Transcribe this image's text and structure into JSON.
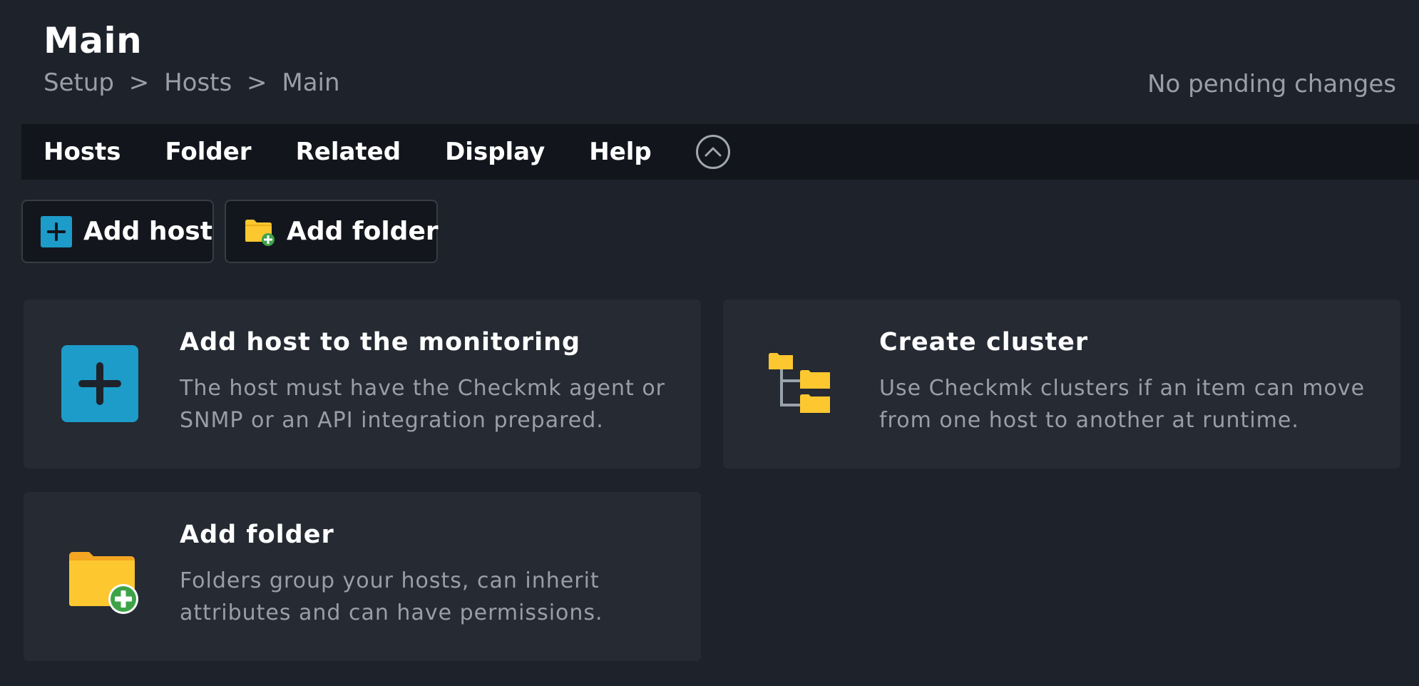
{
  "header": {
    "title": "Main",
    "breadcrumb": [
      "Setup",
      "Hosts",
      "Main"
    ],
    "separator": ">",
    "pending_changes": "No pending changes"
  },
  "menubar": {
    "items": [
      "Hosts",
      "Folder",
      "Related",
      "Display",
      "Help"
    ],
    "collapse_icon": "chevron-up-circle-icon"
  },
  "actions": {
    "add_host": "Add host",
    "add_folder": "Add folder"
  },
  "cards": [
    {
      "title": "Add host to the monitoring",
      "description": "The host must have the Checkmk agent or SNMP or an API integration prepared.",
      "icon": "add-host-icon"
    },
    {
      "title": "Create cluster",
      "description": "Use Checkmk clusters if an item can move from one host to another at runtime.",
      "icon": "cluster-icon"
    },
    {
      "title": "Add folder",
      "description": "Folders group your hosts, can inherit attributes and can have permissions.",
      "icon": "add-folder-icon"
    }
  ],
  "colors": {
    "background": "#1e222a",
    "menubar": "#12161c",
    "card": "#252a33",
    "accent_blue": "#1d9bc9",
    "folder_yellow": "#fdc730",
    "plus_green": "#3ea348",
    "muted_text": "#9a9ea6"
  }
}
